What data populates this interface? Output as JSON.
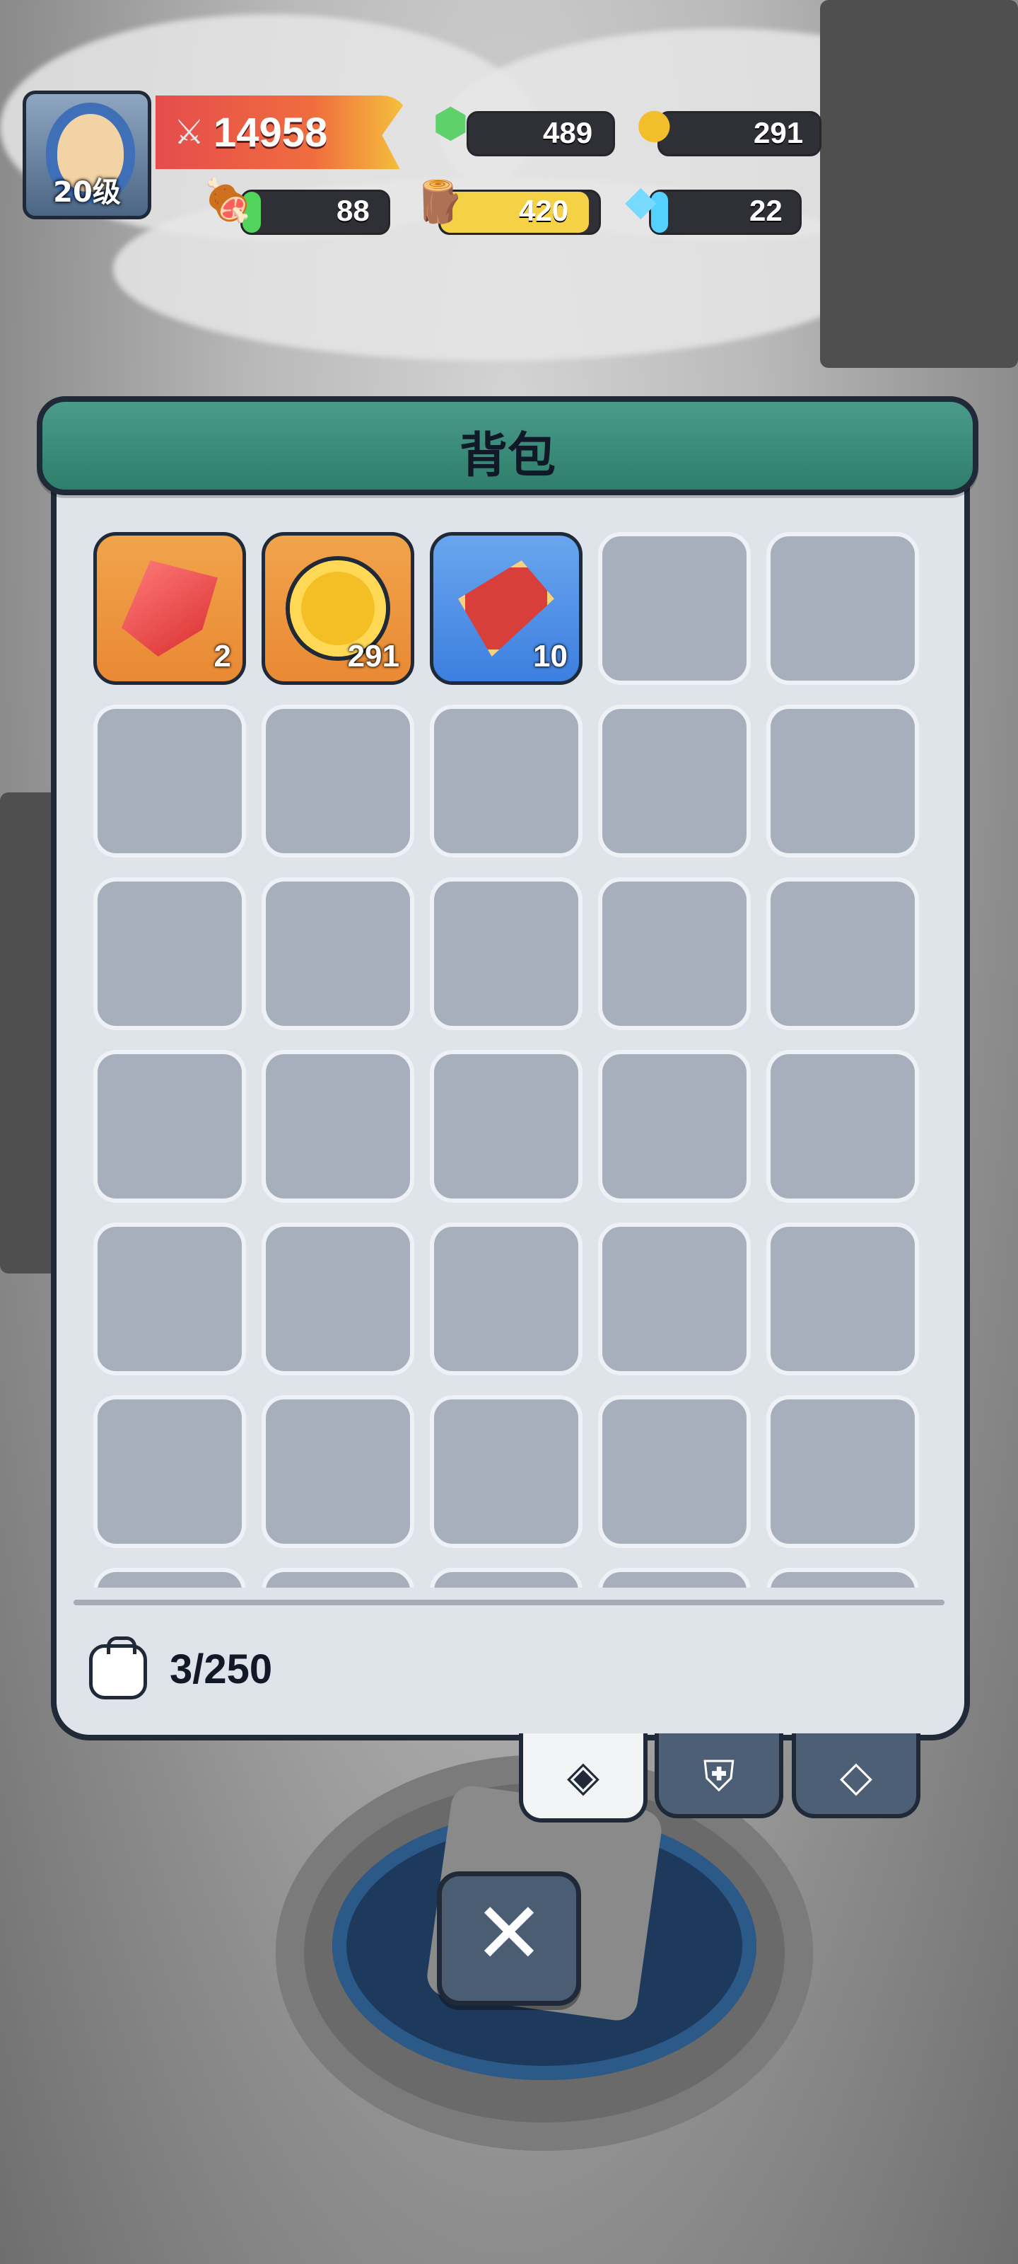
{
  "hud": {
    "avatar": {
      "level": "20级",
      "icon": "mage-avatar"
    },
    "power": {
      "icon": "crossed-swords-icon",
      "value": "14958"
    },
    "resources": [
      {
        "id": "green-cube",
        "icon": "green-cube-plus",
        "value": "489",
        "color": "#5fd16a"
      },
      {
        "id": "gold",
        "icon": "gold-coin",
        "value": "291",
        "color": "#f2bf2b"
      },
      {
        "id": "meat",
        "icon": "meat",
        "value": "88",
        "color": "#52d35b"
      },
      {
        "id": "wood",
        "icon": "wood-log",
        "value": "420",
        "color": "#f4d145"
      },
      {
        "id": "crystal",
        "icon": "crystal",
        "value": "22",
        "color": "#54d1ff"
      }
    ]
  },
  "panel": {
    "title": "背包",
    "capacity_text": "3/250"
  },
  "inventory": {
    "items": [
      {
        "type": "gem",
        "count": "2",
        "background": "orange"
      },
      {
        "type": "coin",
        "count": "291",
        "background": "orange"
      },
      {
        "type": "ticket",
        "count": "10",
        "background": "blue"
      }
    ]
  },
  "tabs": [
    {
      "id": "bag",
      "active": true,
      "icon": "money-bag"
    },
    {
      "id": "armor",
      "active": false,
      "icon": "armor"
    },
    {
      "id": "gem-tab",
      "active": false,
      "icon": "diamond-plus"
    }
  ],
  "close_button": {
    "icon": "x-icon"
  }
}
